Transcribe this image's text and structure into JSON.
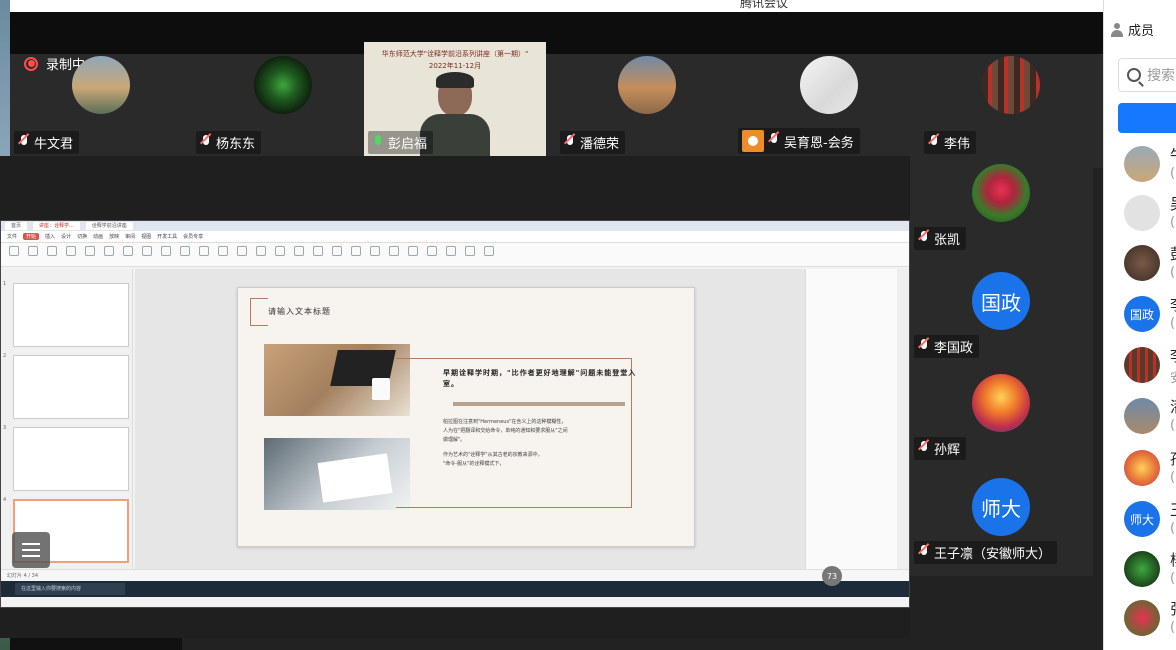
{
  "window": {
    "title": "腾讯会议"
  },
  "recording": {
    "label": "录制中"
  },
  "participants_top": [
    {
      "name": "牛文君",
      "avatar": "landscape-photo",
      "colors": [
        "#8fa7b8",
        "#c9a777",
        "#5a6e58"
      ]
    },
    {
      "name": "杨东东",
      "avatar": "plant-photo",
      "colors": [
        "#0c1a0c",
        "#3ea83e",
        "#163016"
      ]
    },
    {
      "name": "彭启福",
      "avatar": "video-feed",
      "colors": [
        "#e9e4d8"
      ]
    },
    {
      "name": "潘德荣",
      "avatar": "town-photo",
      "colors": [
        "#6f8aa6",
        "#c68d5a",
        "#8a6a4a"
      ]
    },
    {
      "name": "吴育恩-会务",
      "avatar": "pale-photo",
      "colors": [
        "#f5f5f5",
        "#d9d9d9",
        "#e8e8e8"
      ]
    },
    {
      "name": "李伟",
      "avatar": "library-photo",
      "colors": [
        "#3c2a22",
        "#b8322a",
        "#6b4a3a"
      ]
    }
  ],
  "host_slide": {
    "line1": "华东师范大学\"诠释学前沿系列讲座（第一期）\"",
    "line2": "2022年11-12月"
  },
  "participants_side": [
    {
      "name": "张凯",
      "avatar": "flower-photo",
      "text": ""
    },
    {
      "name": "李国政",
      "avatar": "text-avatar",
      "text": "国政"
    },
    {
      "name": "孙辉",
      "avatar": "sunset-photo",
      "text": ""
    },
    {
      "name": "王子凛（安徽师大）",
      "avatar": "text-avatar",
      "text": "师大"
    }
  ],
  "shared_screen": {
    "tabs": [
      "首页",
      "讲座：诠释学...",
      "诠释学前沿讲座"
    ],
    "menu": [
      "文件",
      "开始",
      "插入",
      "设计",
      "切换",
      "动画",
      "放映",
      "审阅",
      "视图",
      "开发工具",
      "会员专享"
    ],
    "slide_title": "请输入文本标题",
    "slide_heading": "早期诠释学时期，\"比作者更好地理解\"问题未能登堂入室。",
    "slide_body": [
      "柏拉图在注意到\"Hermeneus\"在含义上的这种模糊性，",
      "人为在\"把翻译和交给命令，单纯的通知和要求服从\"之间",
      "做理解\"。",
      "作为艺术的\"诠释学\"从其古老的宗教来源中，",
      "\"命令-服从\"的诠释模式下，"
    ],
    "status_left": "幻灯片 4 / 34",
    "taskbar_search": "在这里输入你要搜索的内容",
    "zoom": "73"
  },
  "members_panel": {
    "header": "成员",
    "search_placeholder": "搜索",
    "list": [
      {
        "initial": "牛",
        "sub": "(",
        "avatar": "photo",
        "color": "#9aaab5"
      },
      {
        "initial": "吴",
        "sub": "(",
        "avatar": "photo",
        "color": "#e2e2e2"
      },
      {
        "initial": "彭",
        "sub": "(",
        "avatar": "photo",
        "color": "#7a5a48"
      },
      {
        "initial": "李",
        "sub": "(",
        "avatar": "text",
        "text": "国政",
        "color": "#1a73e8"
      },
      {
        "initial": "李",
        "sub": "安",
        "avatar": "photo",
        "color": "#5a3a2a"
      },
      {
        "initial": "潘",
        "sub": "(",
        "avatar": "photo",
        "color": "#a88a6a"
      },
      {
        "initial": "孙",
        "sub": "(",
        "avatar": "photo",
        "color": "#e87b3a"
      },
      {
        "initial": "王",
        "sub": "(",
        "avatar": "text",
        "text": "师大",
        "color": "#1a73e8"
      },
      {
        "initial": "杨",
        "sub": "(",
        "avatar": "photo",
        "color": "#1a2a1a"
      },
      {
        "initial": "张",
        "sub": "(",
        "avatar": "photo",
        "color": "#c93a5a"
      }
    ]
  }
}
